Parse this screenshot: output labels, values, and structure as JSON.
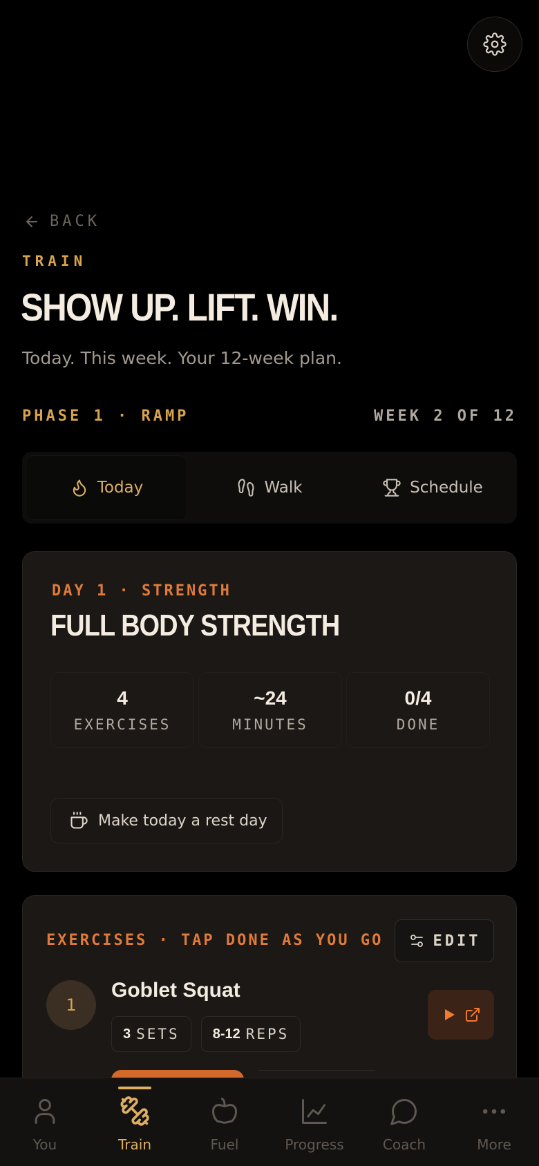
{
  "header": {
    "settings_icon": "gear-icon",
    "back_label": "BACK",
    "eyebrow": "TRAIN",
    "title": "SHOW UP. LIFT. WIN.",
    "subtitle": "Today. This week. Your 12-week plan.",
    "phase": "PHASE 1 · RAMP",
    "week": "WEEK 2 OF 12"
  },
  "tabs": [
    {
      "label": "Today",
      "icon": "flame-icon",
      "active": true
    },
    {
      "label": "Walk",
      "icon": "footprints-icon",
      "active": false
    },
    {
      "label": "Schedule",
      "icon": "trophy-icon",
      "active": false
    }
  ],
  "workout": {
    "day_label": "DAY 1 · STRENGTH",
    "title": "FULL BODY STRENGTH",
    "stats": [
      {
        "value": "4",
        "label": "EXERCISES"
      },
      {
        "value": "~24",
        "label": "MINUTES"
      },
      {
        "value": "0/4",
        "label": "DONE"
      }
    ],
    "rest_label": "Make today a rest day"
  },
  "exercises": {
    "header": "EXERCISES · TAP DONE AS YOU GO",
    "edit_label": "EDIT",
    "items": [
      {
        "number": "1",
        "name": "Goblet Squat",
        "sets": "3",
        "sets_unit": "SETS",
        "reps": "8-12",
        "reps_unit": "REPS"
      }
    ]
  },
  "nav": [
    {
      "label": "You",
      "icon": "person-icon",
      "active": false
    },
    {
      "label": "Train",
      "icon": "dumbbell-icon",
      "active": true
    },
    {
      "label": "Fuel",
      "icon": "apple-icon",
      "active": false
    },
    {
      "label": "Progress",
      "icon": "chart-icon",
      "active": false
    },
    {
      "label": "Coach",
      "icon": "chat-icon",
      "active": false
    },
    {
      "label": "More",
      "icon": "more-icon",
      "active": false
    }
  ],
  "colors": {
    "accent_gold": "#dcaf63",
    "accent_orange": "#e07a3a",
    "background": "#000000",
    "card": "#1b1816"
  }
}
